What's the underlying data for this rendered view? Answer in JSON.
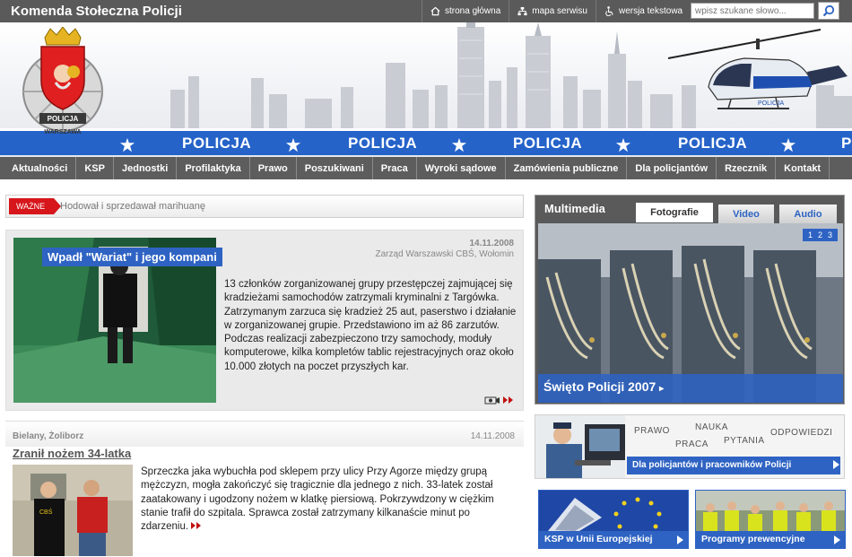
{
  "header": {
    "site_title": "Komenda Stołeczna Policji",
    "links": [
      {
        "label": "strona główna",
        "icon": "home-icon"
      },
      {
        "label": "mapa serwisu",
        "icon": "sitemap-icon"
      },
      {
        "label": "wersja tekstowa",
        "icon": "accessibility-icon"
      }
    ],
    "search_placeholder": "wpisz szukane słowo..."
  },
  "banner": {
    "stripe_word": "POLICJA",
    "crest_text_top": "POLICJA",
    "crest_text_bottom": "WARSZAWA",
    "helicopter_label": "POLICJA"
  },
  "nav": {
    "items": [
      "Aktualności",
      "KSP",
      "Jednostki",
      "Profilaktyka",
      "Prawo",
      "Poszukiwani",
      "Praca",
      "Wyroki sądowe",
      "Zamówienia publiczne",
      "Dla policjantów",
      "Rzecznik",
      "Kontakt"
    ]
  },
  "breaking": {
    "label": "WAŻNE",
    "text": "Hodował i sprzedawał marihuanę"
  },
  "featured": {
    "title": "Wpadł \"Wariat\" i jego kompani",
    "date": "14.11.2008",
    "source": "Zarząd Warszawski CBŚ, Wołomin",
    "text": "13 członków zorganizowanej grupy przestępczej zajmującej się kradzieżami samochodów zatrzymali kryminalni z Targówka. Zatrzymanym zarzuca się kradzież 25 aut, paserstwo i działanie w zorganizowanej grupie. Przedstawiono im aż 86 zarzutów. Podczas realizacji zabezpieczono trzy samochody, moduły komputerowe, kilka kompletów tablic rejestracyjnych oraz około 10.000 złotych na poczet przyszłych kar."
  },
  "news2": {
    "location": "Bielany, Żoliborz",
    "date": "14.11.2008",
    "title": "Zranił nożem 34-latka",
    "text": "Sprzeczka jaka wybuchła pod sklepem przy ulicy Przy Agorze między grupą mężczyzn, mogła zakończyć się tragicznie dla jednego z nich. 33-latek został zaatakowany i ugodzony nożem w klatkę piersiową. Pokrzywdzony w ciężkim stanie trafił do szpitala. Sprawca został zatrzymany kilkanaście minut po zdarzeniu."
  },
  "multimedia": {
    "title": "Multimedia",
    "tabs": [
      "Fotografie",
      "Video",
      "Audio"
    ],
    "pages": [
      "1",
      "2",
      "3"
    ],
    "caption": "Święto Policji 2007"
  },
  "police_box": {
    "words": [
      "PRAWO",
      "NAUKA",
      "PRACA",
      "PYTANIA",
      "ODPOWIEDZI"
    ],
    "label": "Dla policjantów i pracowników Policji"
  },
  "promos": [
    {
      "label": "KSP w Unii Europejskiej"
    },
    {
      "label": "Programy prewencyjne"
    }
  ],
  "colors": {
    "accent_blue": "#2e63c3",
    "stripe_blue": "#2563c9",
    "bar_gray": "#5a5a5a",
    "alert_red": "#d6161b"
  }
}
